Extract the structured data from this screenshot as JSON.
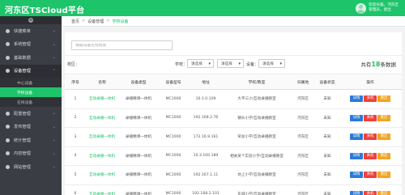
{
  "header": {
    "brand": "河东区TSCloud平台",
    "user_line1": "欢迎光临，河东区",
    "user_line2": "管理员，退出"
  },
  "sidebar": {
    "items": [
      {
        "label": "快捷菜单",
        "expanded": false
      },
      {
        "label": "系统管理",
        "expanded": false
      },
      {
        "label": "基础数据",
        "expanded": false
      },
      {
        "label": "设备管理",
        "expanded": true
      },
      {
        "label": "配置管理",
        "expanded": false
      },
      {
        "label": "发布管理",
        "expanded": false
      },
      {
        "label": "统计管理",
        "expanded": false
      },
      {
        "label": "内容管理",
        "expanded": false
      },
      {
        "label": "网站管理",
        "expanded": false
      }
    ],
    "sub_items": [
      {
        "label": "中心设备",
        "active": false
      },
      {
        "label": "学校设备",
        "active": true
      },
      {
        "label": "在线设备",
        "active": false
      }
    ]
  },
  "breadcrumb": [
    "首页",
    "设备管理",
    "学校设备"
  ],
  "search": {
    "placeholder": "根据设备名称搜索"
  },
  "filters": {
    "district_label": "校区：",
    "school_label": "学校：",
    "school_value": "请选择",
    "grade_value": "请选择",
    "device_label": "设备：",
    "device_value": "请选择",
    "total_prefix": "共有",
    "total_count": "18",
    "total_suffix": "条数据"
  },
  "table": {
    "columns": [
      "序号",
      "名称",
      "设备类型",
      "设备型号",
      "地址",
      "学校/教室",
      "归属地",
      "设备状态",
      "操作"
    ],
    "rows": [
      {
        "no": "1",
        "name": "互动录播一体机",
        "type": "录播精课一体机",
        "model": "MC1000",
        "address": "10.1.0.109",
        "school": "大平三小/互动录播教室",
        "region": "河东区",
        "status": "未知"
      },
      {
        "no": "2",
        "name": "互动录播一体机",
        "type": "录播精课一体机",
        "model": "MC1000",
        "address": "192.168.2.76",
        "school": "镇头小学/互动录播教室",
        "region": "河东区",
        "status": "未知"
      },
      {
        "no": "3",
        "name": "互动录播一体机",
        "type": "录播精课一体机",
        "model": "MC1000",
        "address": "172.16.9.161",
        "school": "荣总小学/互动录播教室",
        "region": "河东区",
        "status": "未知"
      },
      {
        "no": "4",
        "name": "互动录播一体机",
        "type": "录播精课一体机",
        "model": "MC1000",
        "address": "10.3.100.189",
        "school": "相关某个实验小学/互动录播教室",
        "region": "河东区",
        "status": "未知"
      },
      {
        "no": "5",
        "name": "互动录播一体机",
        "type": "录播精课一体机",
        "model": "MC1000",
        "address": "192.167.1.11",
        "school": "坊上小学/互动录播教室",
        "region": "河东区",
        "status": "未知"
      },
      {
        "no": "6",
        "name": "互动录播一体机",
        "type": "录播精课一体机",
        "model": "MC1000",
        "address": "192.168.2.101",
        "school": "东城小学/互动录播教室",
        "region": "河东区",
        "status": "未知"
      }
    ],
    "actions": {
      "detail": "详情",
      "shutdown": "关机",
      "restart": "重启"
    }
  },
  "colors": {
    "accent": "#1ec46a",
    "sidebar": "#3a3d44",
    "detail": "#2d7ad6",
    "shutdown": "#f0413a",
    "restart": "#f3a521"
  }
}
